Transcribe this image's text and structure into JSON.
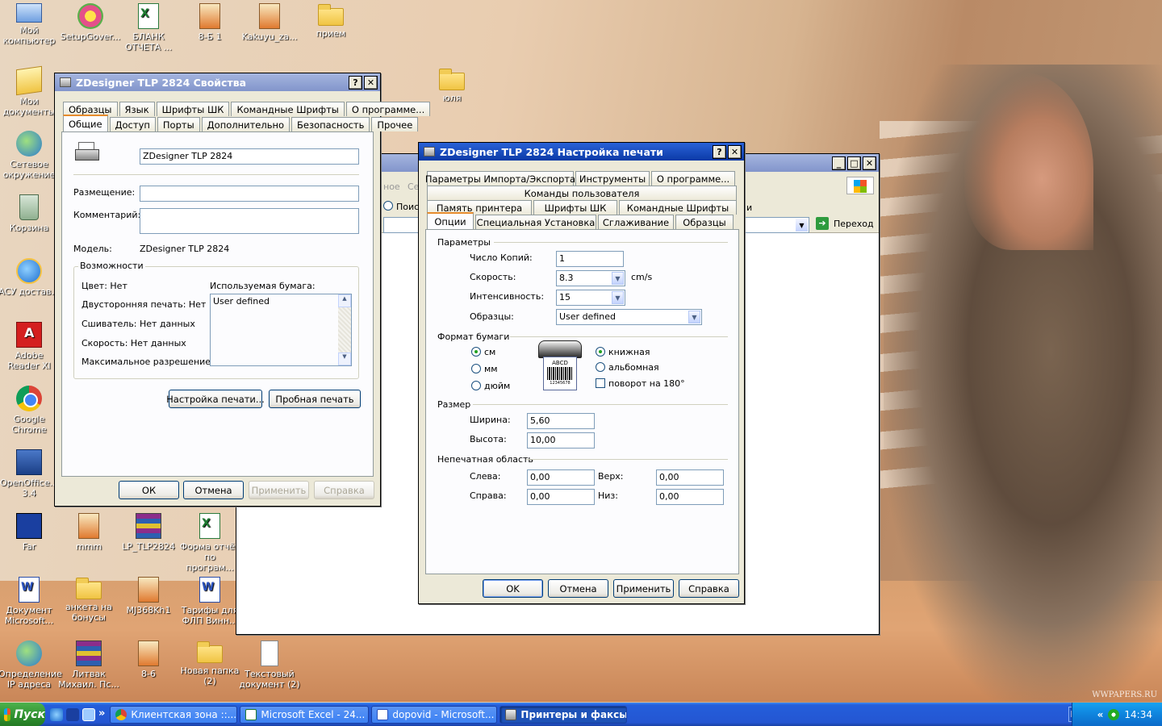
{
  "desktop": {
    "icons": [
      {
        "label": "Мой компьютер",
        "icon": "my-computer-icon"
      },
      {
        "label": "SetupGover...",
        "icon": "setup-flower-icon"
      },
      {
        "label": "БЛАНК ОТЧЕТА ...",
        "icon": "excel-file-icon"
      },
      {
        "label": "8-Б 1",
        "icon": "image-file-icon"
      },
      {
        "label": "Kakuyu_za...",
        "icon": "image-file-icon"
      },
      {
        "label": "прием",
        "icon": "folder-icon"
      },
      {
        "label": "Мои документы",
        "icon": "my-documents-icon"
      },
      {
        "label": "юля",
        "icon": "folder-icon"
      },
      {
        "label": "Сетевое окружение",
        "icon": "network-icon"
      },
      {
        "label": "Корзина",
        "icon": "recycle-bin-icon"
      },
      {
        "label": "АСУ достав...",
        "icon": "internet-explorer-icon"
      },
      {
        "label": "Adobe Reader XI",
        "icon": "adobe-reader-icon"
      },
      {
        "label": "Google Chrome",
        "icon": "chrome-icon"
      },
      {
        "label": "OpenOffice... 3.4",
        "icon": "openoffice-icon"
      },
      {
        "label": "Far",
        "icon": "far-manager-icon"
      },
      {
        "label": "mmm",
        "icon": "image-file-icon"
      },
      {
        "label": "LP_TLP2824",
        "icon": "rar-archive-icon"
      },
      {
        "label": "Форма отчёт по програм...",
        "icon": "excel-file-icon"
      },
      {
        "label": "Документ Microsoft...",
        "icon": "word-file-icon"
      },
      {
        "label": "анкета на бонусы",
        "icon": "folder-icon"
      },
      {
        "label": "MJ368Kh1",
        "icon": "image-file-icon"
      },
      {
        "label": "Тарифы для ФЛП Винн...",
        "icon": "word-file-icon"
      },
      {
        "label": "Определение IP адреса",
        "icon": "network-icon"
      },
      {
        "label": "Литвак Михаил. Пс...",
        "icon": "rar-archive-icon"
      },
      {
        "label": "8-6",
        "icon": "image-file-icon"
      },
      {
        "label": "Новая папка (2)",
        "icon": "folder-icon"
      },
      {
        "label": "Текстовый документ (2)",
        "icon": "text-file-icon"
      }
    ],
    "watermark": "WWPAPERS.RU"
  },
  "props_window": {
    "title": "ZDesigner TLP 2824 Свойства",
    "help": "?",
    "close": "✕",
    "tabs_row1": [
      "Образцы",
      "Язык",
      "Шрифты ШК",
      "Командные Шрифты",
      "О программе..."
    ],
    "tabs_row2": [
      "Общие",
      "Доступ",
      "Порты",
      "Дополнительно",
      "Безопасность",
      "Прочее"
    ],
    "printer_name": "ZDesigner TLP 2824",
    "location_label": "Размещение:",
    "location_value": "",
    "comment_label": "Комментарий:",
    "comment_value": "",
    "model_label": "Модель:",
    "model_value": "ZDesigner TLP 2824",
    "features_title": "Возможности",
    "color": "Цвет: Нет",
    "duplex": "Двусторонняя печать: Нет",
    "staple": "Сшиватель: Нет данных",
    "speed": "Скорость: Нет данных",
    "max_res": "Максимальное разрешение:",
    "paper_label": "Используемая бумага:",
    "paper_list": [
      "User defined"
    ],
    "btn_setup": "Настройка печати...",
    "btn_test": "Пробная печать",
    "ok": "ОК",
    "cancel": "Отмена",
    "apply": "Применить",
    "help_btn": "Справка"
  },
  "bg_window": {
    "search_radio": "Поиск",
    "partial_left": "ное",
    "partial_left2": "Се",
    "partial_tab": "и",
    "go_label": "Переход",
    "icons_top": "ie-icon"
  },
  "print_window": {
    "title": "ZDesigner TLP 2824 Настройка печати",
    "help": "?",
    "close": "✕",
    "tabs_row1": [
      "Параметры Импорта/Экспорта",
      "Инструменты",
      "О программе..."
    ],
    "tabs_row2": [
      "Команды пользователя"
    ],
    "tabs_row3": [
      "Память принтера",
      "Шрифты ШК",
      "Командные Шрифты"
    ],
    "tabs_row4": [
      "Опции",
      "Специальная Установка",
      "Сглаживание",
      "Образцы"
    ],
    "params_title": "Параметры",
    "copies_label": "Число Копий:",
    "copies_value": "1",
    "speed_label": "Скорость:",
    "speed_value": "8.3",
    "speed_unit": "cm/s",
    "intensity_label": "Интенсивность:",
    "intensity_value": "15",
    "samples_label": "Образцы:",
    "samples_value": "User defined",
    "paper_format_title": "Формат бумаги",
    "unit_cm": "см",
    "unit_mm": "мм",
    "unit_inch": "дюйм",
    "label_text": "ABCD",
    "label_barcode": "12345678",
    "portrait": "книжная",
    "landscape": "альбомная",
    "rotate": "поворот на 180°",
    "size_title": "Размер",
    "width_label": "Ширина:",
    "width_value": "5,60",
    "height_label": "Высота:",
    "height_value": "10,00",
    "nonprint_title": "Непечатная область",
    "left_label": "Слева:",
    "left_value": "0,00",
    "top_label": "Верх:",
    "top_value": "0,00",
    "right_label": "Справа:",
    "right_value": "0,00",
    "bottom_label": "Низ:",
    "bottom_value": "0,00",
    "ok": "OK",
    "cancel": "Отмена",
    "apply": "Применить",
    "help_btn": "Справка"
  },
  "taskbar": {
    "start": "Пуск",
    "chevron": "»",
    "tasks": [
      {
        "label": "Клиентская зона ::..."
      },
      {
        "label": "Microsoft Excel - 24..."
      },
      {
        "label": "dopovid - Microsoft..."
      },
      {
        "label": "Принтеры и факсы"
      }
    ],
    "lang": "EN",
    "tray_chevron": "«",
    "time": "14:34"
  }
}
